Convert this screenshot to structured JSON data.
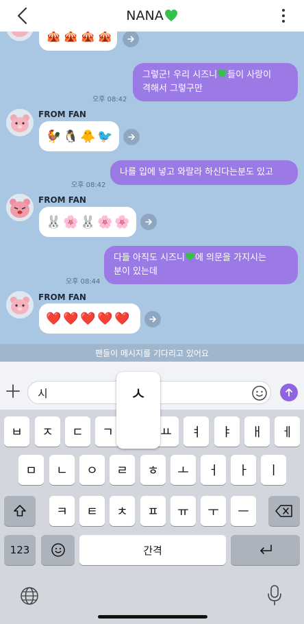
{
  "header": {
    "title": "NANA",
    "back_icon": "chevron-left-icon",
    "menu_icon": "more-vertical-icon",
    "heart_color": "#36c14b"
  },
  "chat": {
    "messages": [
      {
        "from": "fan",
        "emojis": [
          "🎪",
          "🎪",
          "🎪",
          "🎪"
        ],
        "share_icon": "arrow-right-icon"
      },
      {
        "from": "me",
        "line1_before": "그렇군! 우리 시즈니",
        "line1_after": "들이 사랑이",
        "line2": "격해서 그렇구만",
        "time": "오후 08:42"
      },
      {
        "from": "fan",
        "sender": "FROM FAN",
        "emojis": [
          "🐓",
          "🐧",
          "🐥",
          "🐦"
        ]
      },
      {
        "from": "me",
        "text": "나를 입에 넣고 와랄라 하신다는분도 있고",
        "time": "오후 08:42"
      },
      {
        "from": "fan",
        "sender": "FROM FAN",
        "emojis": [
          "🐰",
          "🌸",
          "🐰",
          "🌸",
          "🌸"
        ]
      },
      {
        "from": "me",
        "line1_before": "다들 아직도 시즈니",
        "line1_after": "에 의문을 가지시는",
        "line2": "분이 있는데",
        "time": "오후 08:44"
      },
      {
        "from": "fan",
        "sender": "FROM FAN",
        "emojis": [
          "❤️",
          "❤️",
          "❤️",
          "❤️",
          "❤️"
        ]
      }
    ],
    "notice": "팬들이 메시지를 기다리고 있어요"
  },
  "input": {
    "value": "시",
    "plus_icon": "plus-icon",
    "emoji_icon": "smiley-icon",
    "send_icon": "send-arrow-icon",
    "accent": "#9063e0"
  },
  "keyboard": {
    "popup": "ㅅ",
    "row1": [
      "ㅂ",
      "ㅈ",
      "ㄷ",
      "ㄱ",
      "ㅅ",
      "ㅛ",
      "ㅕ",
      "ㅑ",
      "ㅐ",
      "ㅔ"
    ],
    "row2": [
      "ㅁ",
      "ㄴ",
      "ㅇ",
      "ㄹ",
      "ㅎ",
      "ㅗ",
      "ㅓ",
      "ㅏ",
      "ㅣ"
    ],
    "row3": [
      "ㅋ",
      "ㅌ",
      "ㅊ",
      "ㅍ",
      "ㅠ",
      "ㅜ",
      "ㅡ"
    ],
    "numbers": "123",
    "space": "간격",
    "shift_icon": "shift-icon",
    "backspace_icon": "backspace-icon",
    "emoji_key_icon": "emoji-key-icon",
    "return_icon": "return-icon",
    "globe_icon": "globe-icon",
    "mic_icon": "microphone-icon"
  }
}
